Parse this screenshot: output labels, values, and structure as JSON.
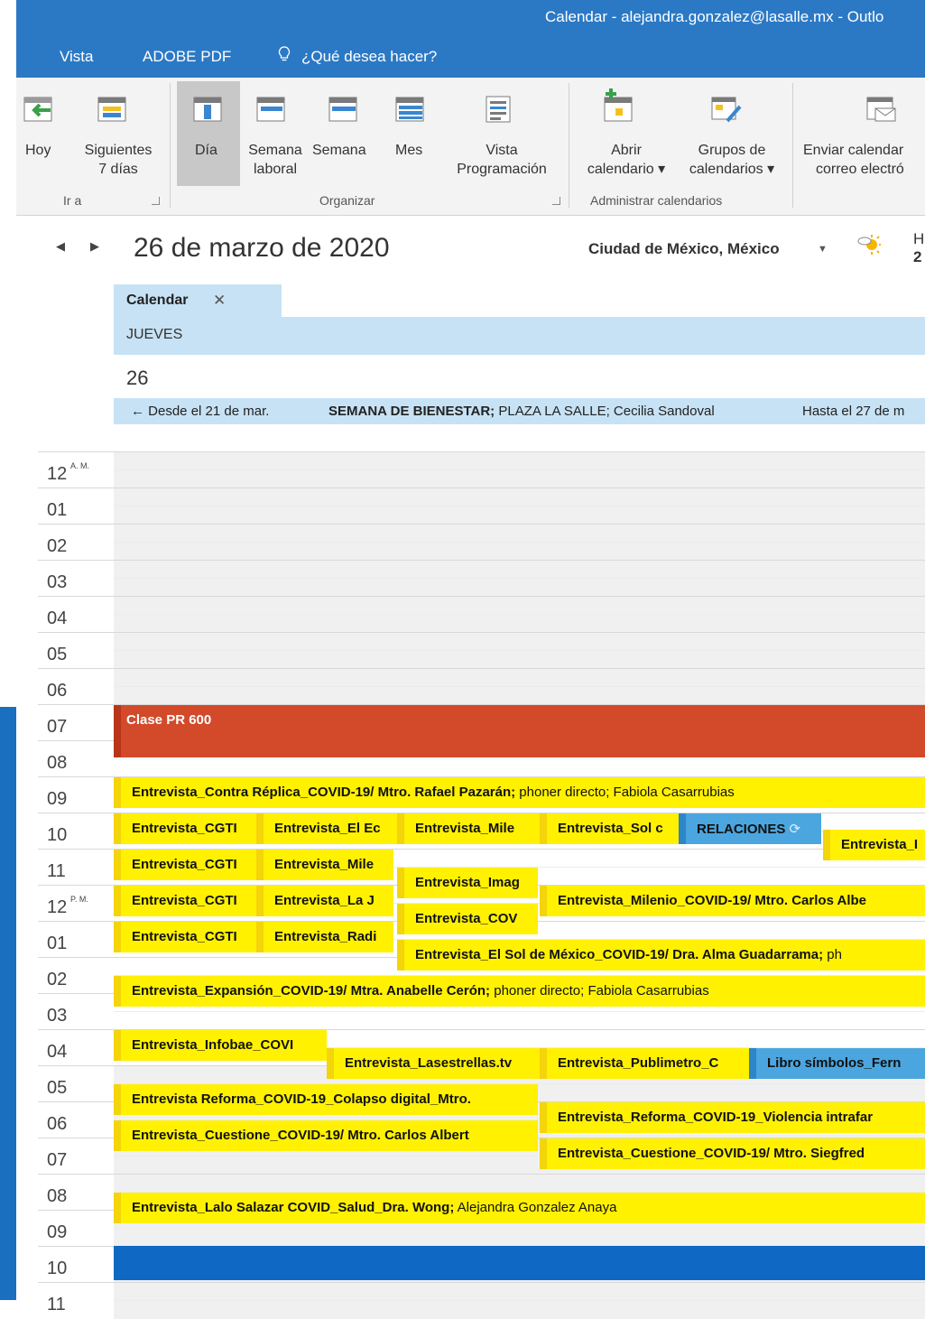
{
  "window": {
    "title": "Calendar - alejandra.gonzalez@lasalle.mx - Outlo"
  },
  "menu": {
    "vista": "Vista",
    "adobe": "ADOBE PDF",
    "search_prompt": "¿Qué desea hacer?"
  },
  "ribbon": {
    "hoy": "Hoy",
    "siguientes_1": "Siguientes",
    "siguientes_2": "7 días",
    "dia": "Día",
    "semana_laboral_1": "Semana",
    "semana_laboral_2": "laboral",
    "semana": "Semana",
    "mes": "Mes",
    "vista_prog_1": "Vista",
    "vista_prog_2": "Programación",
    "abrir_1": "Abrir",
    "abrir_2": "calendario ▾",
    "grupos_1": "Grupos de",
    "grupos_2": "calendarios ▾",
    "enviar_1": "Enviar calendar",
    "enviar_2": "correo electró",
    "group_ira": "Ir a",
    "group_organizar": "Organizar",
    "group_admin": "Administrar calendarios"
  },
  "nav": {
    "date_title": "26 de marzo de 2020",
    "city": "Ciudad de México, México",
    "weather_line1": "H",
    "weather_line2": "2"
  },
  "tab": {
    "label": "Calendar",
    "close": "✕",
    "day_name": "JUEVES",
    "day_number": "26"
  },
  "allday": {
    "from": "← Desde el 21 de mar.",
    "title": "SEMANA DE BIENESTAR;",
    "detail": " PLAZA LA SALLE; Cecilia Sandoval",
    "until": "Hasta el 27 de m"
  },
  "hours": [
    {
      "h": "12",
      "ampm": "A. M."
    },
    {
      "h": "01",
      "ampm": ""
    },
    {
      "h": "02",
      "ampm": ""
    },
    {
      "h": "03",
      "ampm": ""
    },
    {
      "h": "04",
      "ampm": ""
    },
    {
      "h": "05",
      "ampm": ""
    },
    {
      "h": "06",
      "ampm": ""
    },
    {
      "h": "07",
      "ampm": ""
    },
    {
      "h": "08",
      "ampm": ""
    },
    {
      "h": "09",
      "ampm": ""
    },
    {
      "h": "10",
      "ampm": ""
    },
    {
      "h": "11",
      "ampm": ""
    },
    {
      "h": "12",
      "ampm": "P. M."
    },
    {
      "h": "01",
      "ampm": ""
    },
    {
      "h": "02",
      "ampm": ""
    },
    {
      "h": "03",
      "ampm": ""
    },
    {
      "h": "04",
      "ampm": ""
    },
    {
      "h": "05",
      "ampm": ""
    },
    {
      "h": "06",
      "ampm": ""
    },
    {
      "h": "07",
      "ampm": ""
    },
    {
      "h": "08",
      "ampm": ""
    },
    {
      "h": "09",
      "ampm": ""
    },
    {
      "h": "10",
      "ampm": ""
    },
    {
      "h": "11",
      "ampm": ""
    }
  ],
  "events": {
    "clase": "Clase PR 600",
    "e1b": "Entrevista_Contra Réplica_COVID-19/ Mtro. Rafael Pazarán;",
    "e1n": " phoner  directo; Fabiola Casarrubias",
    "e2": "Entrevista_CGTI",
    "e3": "Entrevista_El Ec",
    "e4": "Entrevista_Mile",
    "e5": "Entrevista_Sol c",
    "e6": "RELACIONES",
    "e7": "Entrevista_I",
    "e8": "Entrevista_CGTI",
    "e9": "Entrevista_Mile",
    "e10": "Entrevista_Imag",
    "e11": "Entrevista_CGTI",
    "e12": "Entrevista_La J",
    "e13": "Entrevista_Milenio_COVID-19/ Mtro. Carlos Albe",
    "e14": "Entrevista_COV",
    "e15": "Entrevista_CGTI",
    "e16": "Entrevista_Radi",
    "e17b": "Entrevista_El Sol de México_COVID-19/ Dra. Alma Guadarrama;",
    "e17n": " ph",
    "e18b": "Entrevista_Expansión_COVID-19/ Mtra. Anabelle Cerón;",
    "e18n": " phoner  directo; Fabiola Casarrubias",
    "e19": "Entrevista_Infobae_COVI",
    "e20": "Entrevista_Lasestrellas.tv",
    "e21": "Entrevista_Publimetro_C",
    "e22": "Libro símbolos_Fern",
    "e23": "Entrevista Reforma_COVID-19_Colapso digital_Mtro.",
    "e24": "Entrevista_Reforma_COVID-19_Violencia intrafar",
    "e25": "Entrevista_Cuestione_COVID-19/ Mtro. Carlos Albert",
    "e26": "Entrevista_Cuestione_COVID-19/ Mtro. Siegfred",
    "e27b": "Entrevista_Lalo Salazar COVID_Salud_Dra. Wong;",
    "e27n": " Alejandra Gonzalez Anaya"
  }
}
